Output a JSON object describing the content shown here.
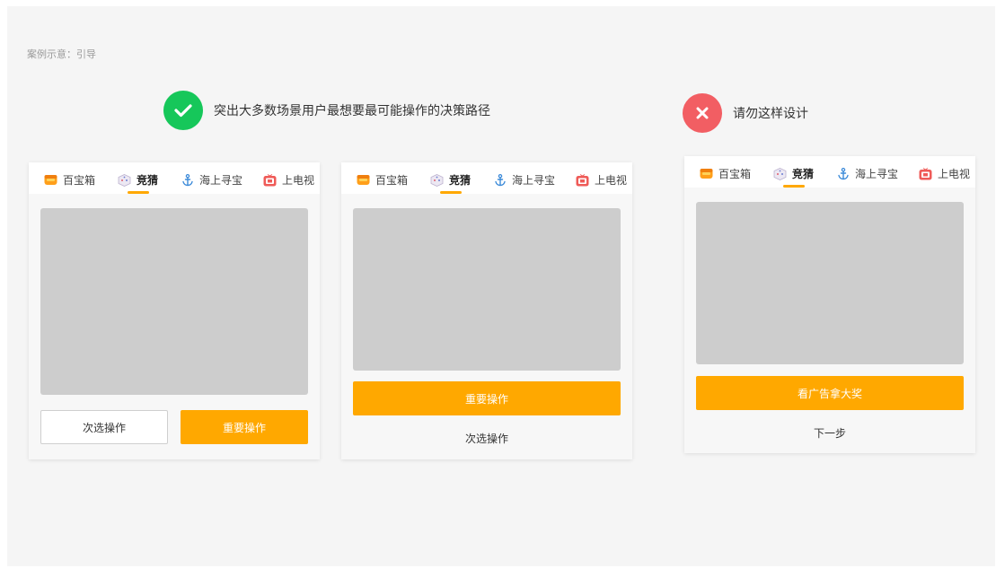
{
  "caption": "案例示意：引导",
  "good": {
    "text": "突出大多数场景用户最想要最可能操作的决策路径"
  },
  "bad": {
    "text": "请勿这样设计"
  },
  "tabs": [
    {
      "label": "百宝箱",
      "icon": "treasure-chest-icon"
    },
    {
      "label": "竞猜",
      "icon": "dice-icon"
    },
    {
      "label": "海上寻宝",
      "icon": "anchor-icon"
    },
    {
      "label": "上电视",
      "icon": "tv-icon"
    }
  ],
  "active_tab": "竞猜",
  "colors": {
    "accent": "#ffa800",
    "good": "#16c75a",
    "bad": "#f25e63",
    "placeholder": "#cdcdcd"
  },
  "mock1": {
    "secondary": "次选操作",
    "primary": "重要操作"
  },
  "mock2": {
    "primary": "重要操作",
    "secondary": "次选操作"
  },
  "mock3": {
    "primary": "看广告拿大奖",
    "secondary": "下一步"
  }
}
